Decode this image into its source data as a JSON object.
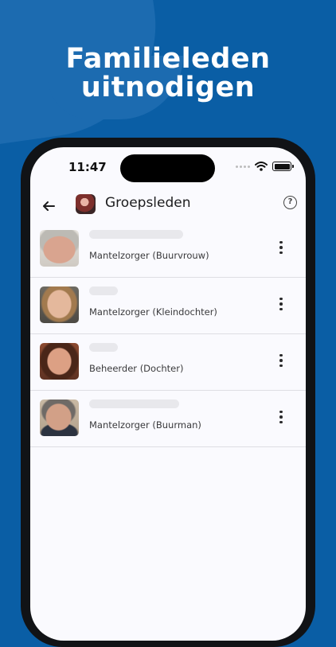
{
  "headline": {
    "line1": "Familieleden",
    "line2": "uitnodigen"
  },
  "status_bar": {
    "time": "11:47"
  },
  "appbar": {
    "title": "Groepsleden"
  },
  "members": [
    {
      "role": "Mantelzorger (Buurvrouw)"
    },
    {
      "role": "Mantelzorger (Kleindochter)"
    },
    {
      "role": "Beheerder (Dochter)"
    },
    {
      "role": "Mantelzorger (Buurman)"
    }
  ],
  "colors": {
    "background": "#0a5ea5",
    "screen": "#fafafe",
    "divider": "#dedee3"
  }
}
